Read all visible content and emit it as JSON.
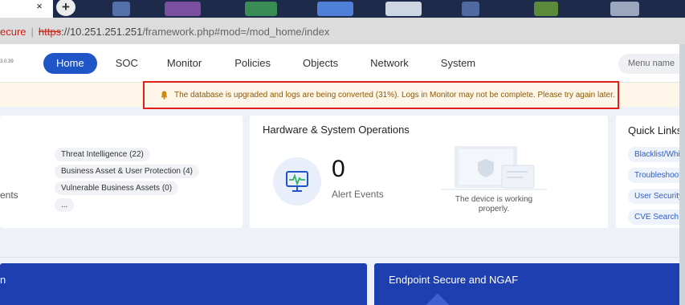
{
  "browser": {
    "close_tab_glyph": "×",
    "new_tab_glyph": "+",
    "address": {
      "security_label": "ecure",
      "separator": "|",
      "scheme": "https",
      "host": "://10.251.251.251",
      "path": "/framework.php#mod=/mod_home/index"
    }
  },
  "header": {
    "version": "3.0.39",
    "nav": [
      {
        "label": "Home",
        "active": true
      },
      {
        "label": "SOC"
      },
      {
        "label": "Monitor"
      },
      {
        "label": "Policies"
      },
      {
        "label": "Objects"
      },
      {
        "label": "Network"
      },
      {
        "label": "System"
      }
    ],
    "menu_search_placeholder": "Menu name"
  },
  "banner": {
    "icon": "bell-icon",
    "text": "The database is upgraded and logs are being converted (31%). Logs in Monitor may not be complete. Please try again later.",
    "conversion_progress": 0.31
  },
  "panel_left": {
    "partial_label": "ents",
    "pills": [
      {
        "label": "Threat Intelligence",
        "count": "(22)"
      },
      {
        "label": "Business Asset & User Protection",
        "count": "(4)"
      },
      {
        "label": "Vulnerable Business Assets",
        "count": "(0)"
      },
      {
        "label": "...",
        "count": ""
      }
    ]
  },
  "panel_hw": {
    "title": "Hardware & System Operations",
    "alert_count": "0",
    "alert_label": "Alert Events",
    "device_status": "The device is working properly."
  },
  "quick_links": {
    "title": "Quick Links",
    "items": [
      "Blacklist/White",
      "Troubleshootin",
      "User Security",
      "CVE Search"
    ]
  },
  "bottom": {
    "left_title": "n",
    "right_title": "Endpoint Secure and NGAF"
  },
  "colors": {
    "primary": "#1f55c6",
    "alert_border": "#e0201b",
    "banner_bg": "#fff6ea",
    "banner_text": "#8a5a00",
    "card_blue": "#1d3fb0"
  }
}
